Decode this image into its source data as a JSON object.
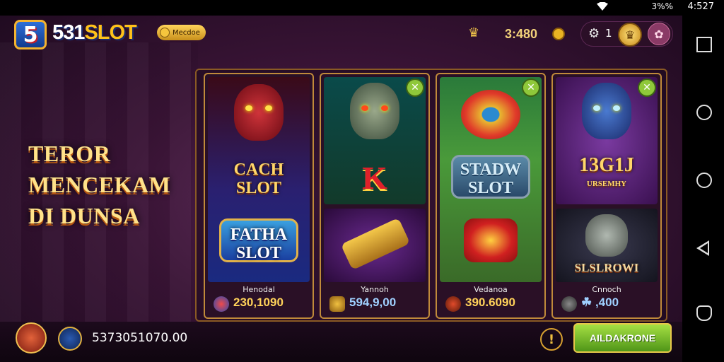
{
  "status_bar": {
    "time": "4:527",
    "indicators": "3%%",
    "wifi_icon": "wifi-icon"
  },
  "app": {
    "logo_text": "5",
    "brand_prefix": "531",
    "brand_suffix": "SLOT",
    "badge_label": "Mecdoe",
    "coins": "3:480",
    "gear_count": "1"
  },
  "promo": {
    "lines": [
      "TEROR",
      "MENCEKAM",
      "DI DUNSA"
    ]
  },
  "cards": [
    {
      "top_title": "CACH\nSLOT",
      "bottom_title": "FATHA\nSLOT",
      "name": "Henodal",
      "value": "230,1090",
      "has_close": false
    },
    {
      "top_title": "K",
      "bottom_title": "",
      "name": "Yannoh",
      "value": "594,9,00",
      "has_close": true
    },
    {
      "top_title": "",
      "bottom_title": "STADW\nSLOT",
      "name": "Vedanoa",
      "value": "390.6090",
      "has_close": true
    },
    {
      "top_title": "13G1J",
      "top_sub": "URSEMHY",
      "bottom_title": "SLSLROWI",
      "name": "Cnnoch",
      "value": "☘ ,400",
      "has_close": true
    }
  ],
  "bottom": {
    "balance": "5373051070.00",
    "cta_label": "AILDAKRONE",
    "info_glyph": "!"
  },
  "colors": {
    "background": "#3a1436",
    "gold": "#ffd25a",
    "cta": "#7fc02e",
    "card_border": "#c08a3a"
  }
}
